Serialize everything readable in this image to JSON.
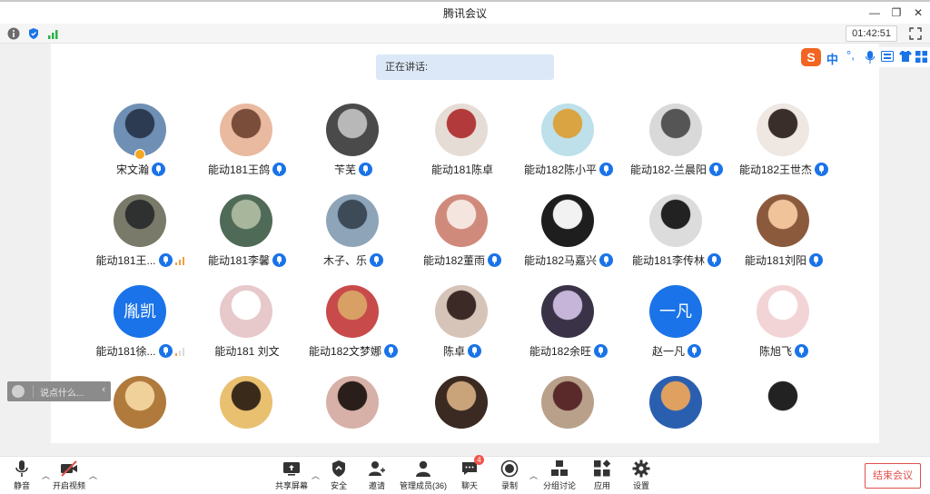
{
  "window": {
    "title": "腾讯会议"
  },
  "status": {
    "timer": "01:42:51"
  },
  "speaking": {
    "label": "正在讲话:"
  },
  "ime": {
    "lang": "中"
  },
  "participants": [
    {
      "name": "宋文瀚",
      "audio": "mic",
      "host": true
    },
    {
      "name": "能动181王鸽",
      "audio": "mic"
    },
    {
      "name": "苄芜",
      "audio": "mic"
    },
    {
      "name": "能动181陈卓",
      "audio": "none"
    },
    {
      "name": "能动182陈小平",
      "audio": "mic"
    },
    {
      "name": "能动182-兰晨阳",
      "audio": "mic"
    },
    {
      "name": "能动182王世杰",
      "audio": "mic"
    },
    {
      "name": "能动181王...",
      "audio": "mic",
      "signal": 3
    },
    {
      "name": "能动181李馨",
      "audio": "mic"
    },
    {
      "name": "木子、乐",
      "audio": "mic"
    },
    {
      "name": "能动182董雨",
      "audio": "mic"
    },
    {
      "name": "能动182马嘉兴",
      "audio": "mic"
    },
    {
      "name": "能动181李传林",
      "audio": "mic"
    },
    {
      "name": "能动181刘阳",
      "audio": "mic"
    },
    {
      "name": "能动181徐...",
      "audio": "mic",
      "signal": 1,
      "avatar_text": "胤凯"
    },
    {
      "name": "能动181 刘文",
      "audio": "none"
    },
    {
      "name": "能动182文梦娜",
      "audio": "mic"
    },
    {
      "name": "陈卓",
      "audio": "mic"
    },
    {
      "name": "能动182余旺",
      "audio": "mic"
    },
    {
      "name": "赵一凡",
      "audio": "mic",
      "avatar_text": "一凡"
    },
    {
      "name": "陈旭飞",
      "audio": "mic"
    }
  ],
  "chat": {
    "placeholder": "说点什么..."
  },
  "toolbar": {
    "mute": "静音",
    "video": "开启视频",
    "share": "共享屏幕",
    "security": "安全",
    "invite": "邀请",
    "members": "管理成员(36)",
    "chat": "聊天",
    "chat_badge": "4",
    "record": "录制",
    "breakout": "分组讨论",
    "apps": "应用",
    "settings": "设置",
    "end": "结束会议"
  },
  "colors": {
    "accent": "#1a73e8",
    "end": "#e0504a",
    "speaking_bg": "#dce8f7"
  }
}
